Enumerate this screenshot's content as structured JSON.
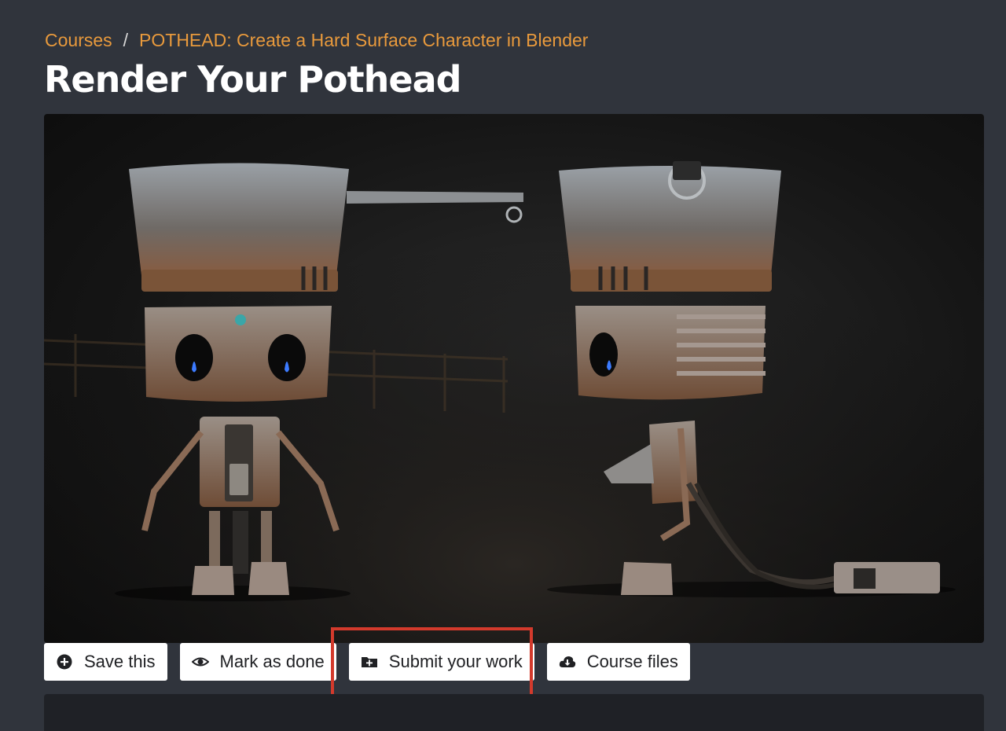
{
  "breadcrumb": {
    "root": "Courses",
    "separator": "/",
    "course": "POTHEAD: Create a Hard Surface Character in Blender"
  },
  "page": {
    "title": "Render Your Pothead"
  },
  "media": {
    "alt": "Pothead robot render"
  },
  "actions": [
    {
      "label": "Save this",
      "icon": "plus-circle-icon"
    },
    {
      "label": "Mark as done",
      "icon": "eye-icon"
    },
    {
      "label": "Submit your work",
      "icon": "folder-plus-icon"
    },
    {
      "label": "Course files",
      "icon": "cloud-download-icon"
    }
  ],
  "colors": {
    "background": "#30343c",
    "link": "#e99a3c",
    "highlight": "#d33a2c",
    "button_bg": "#ffffff"
  }
}
